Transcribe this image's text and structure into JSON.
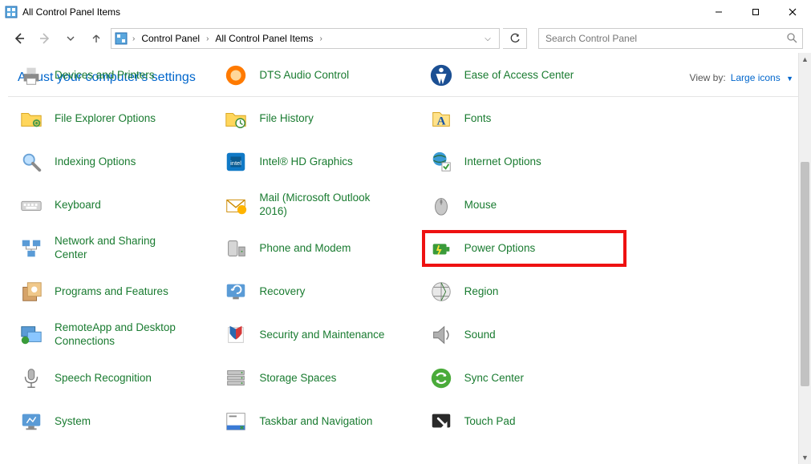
{
  "window": {
    "title": "All Control Panel Items"
  },
  "breadcrumb": {
    "seg1": "Control Panel",
    "seg2": "All Control Panel Items"
  },
  "search": {
    "placeholder": "Search Control Panel"
  },
  "subheader": {
    "heading": "Adjust your computer's settings",
    "viewby_label": "View by:",
    "viewby_value": "Large icons"
  },
  "items": {
    "devices_printers": "Devices and Printers",
    "dts_audio": "DTS Audio Control",
    "ease_access": "Ease of Access Center",
    "file_explorer": "File Explorer Options",
    "file_history": "File History",
    "fonts": "Fonts",
    "indexing": "Indexing Options",
    "intel_hd": "Intel® HD Graphics",
    "internet_opts": "Internet Options",
    "keyboard": "Keyboard",
    "mail": "Mail (Microsoft Outlook 2016)",
    "mouse": "Mouse",
    "network_sharing": "Network and Sharing Center",
    "phone_modem": "Phone and Modem",
    "power_options": "Power Options",
    "programs_features": "Programs and Features",
    "recovery": "Recovery",
    "region": "Region",
    "remoteapp": "RemoteApp and Desktop Connections",
    "security_maint": "Security and Maintenance",
    "sound": "Sound",
    "speech": "Speech Recognition",
    "storage_spaces": "Storage Spaces",
    "sync_center": "Sync Center",
    "system": "System",
    "taskbar_nav": "Taskbar and Navigation",
    "touch_pad": "Touch Pad"
  },
  "highlight_item": "power_options"
}
